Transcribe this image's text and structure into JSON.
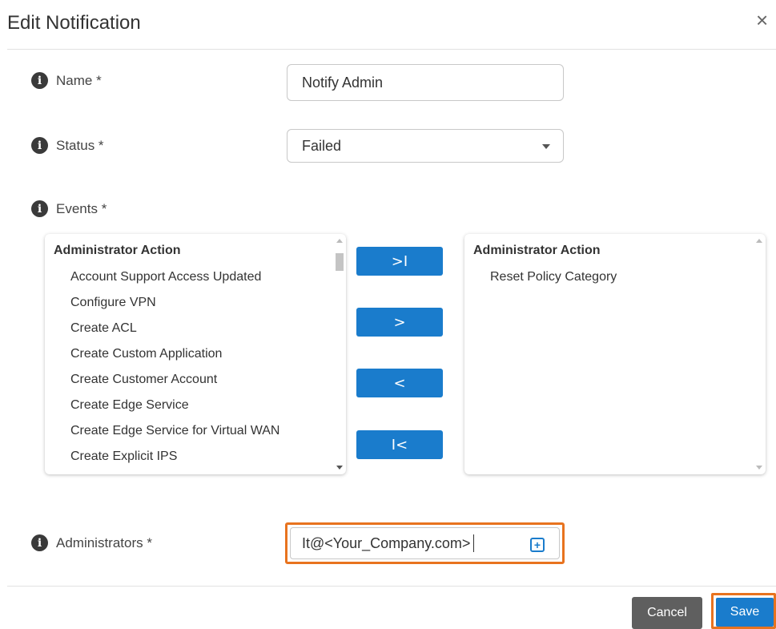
{
  "dialog": {
    "title": "Edit Notification",
    "close_icon": "close-icon",
    "close_glyph": "×"
  },
  "form": {
    "name": {
      "label": "Name *",
      "value": "Notify Admin"
    },
    "status": {
      "label": "Status *",
      "value": "Failed"
    },
    "events": {
      "label": "Events *"
    },
    "administrators": {
      "label": "Administrators *",
      "value": "It@<Your_Company.com>"
    },
    "info_glyph": "i"
  },
  "available_events": {
    "group": "Administrator Action",
    "items": [
      "Account Support Access Updated",
      "Configure VPN",
      "Create ACL",
      "Create Custom Application",
      "Create Customer Account",
      "Create Edge Service",
      "Create Edge Service for Virtual WAN",
      "Create Explicit IPS"
    ]
  },
  "selected_events": {
    "group": "Administrator Action",
    "items": [
      "Reset Policy Category"
    ]
  },
  "move_buttons": {
    "move_all_right": ">I",
    "move_right": ">",
    "move_left": "<",
    "move_all_left": "I<"
  },
  "footer": {
    "cancel_label": "Cancel",
    "save_label": "Save"
  },
  "colors": {
    "accent": "#1a7ccc",
    "highlight": "#e8731f",
    "cancel": "#5f5f5f"
  }
}
